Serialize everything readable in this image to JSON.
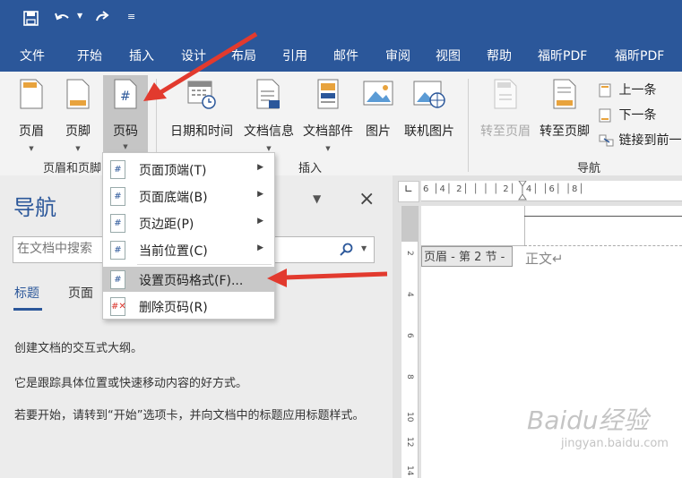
{
  "quick_access": {
    "save_icon": "save-icon",
    "undo_icon": "undo-icon",
    "redo_icon": "redo-icon",
    "customize_icon": "customize-icon"
  },
  "tabs": [
    "文件",
    "开始",
    "插入",
    "设计",
    "布局",
    "引用",
    "邮件",
    "审阅",
    "视图",
    "帮助",
    "福昕PDF",
    "福昕PDF"
  ],
  "ribbon": {
    "header_footer": {
      "header": "页眉",
      "footer": "页脚",
      "page_number": "页码",
      "group_label": "页眉和页脚"
    },
    "insert": {
      "datetime": "日期和时间",
      "docinfo": "文档信息",
      "quickparts": "文档部件",
      "picture": "图片",
      "online_picture": "联机图片",
      "group_label": "插入"
    },
    "navigation": {
      "goto_header": "转至页眉",
      "goto_footer": "转至页脚",
      "previous": "上一条",
      "next": "下一条",
      "link_previous": "链接到前一",
      "group_label": "导航"
    }
  },
  "menu": {
    "items": [
      {
        "label": "页面顶端(T)",
        "submenu": true
      },
      {
        "label": "页面底端(B)",
        "submenu": true
      },
      {
        "label": "页边距(P)",
        "submenu": true
      },
      {
        "label": "当前位置(C)",
        "submenu": true
      },
      {
        "label": "设置页码格式(F)...",
        "submenu": false
      },
      {
        "label": "删除页码(R)",
        "submenu": false
      }
    ]
  },
  "nav_pane": {
    "title": "导航",
    "search_placeholder": "在文档中搜索",
    "tabs": [
      "标题",
      "页面"
    ],
    "texts": [
      "创建文档的交互式大纲。",
      "它是跟踪具体位置或快速移动内容的好方式。",
      "若要开始，请转到“开始”选项卡，并向文档中的标题应用标题样式。"
    ]
  },
  "document": {
    "ruler_top": "6 │4│ 2│ │ │ │ 2│ │4│ │6│ │8│",
    "ruler_left": [
      "2",
      "4",
      "6",
      "8",
      "10",
      "12",
      "14"
    ],
    "section_label": "页眉 - 第 2 节 -",
    "body_text": "正文↵"
  },
  "watermark": {
    "line1": "Baidu经验",
    "line2": "jingyan.baidu.com"
  }
}
